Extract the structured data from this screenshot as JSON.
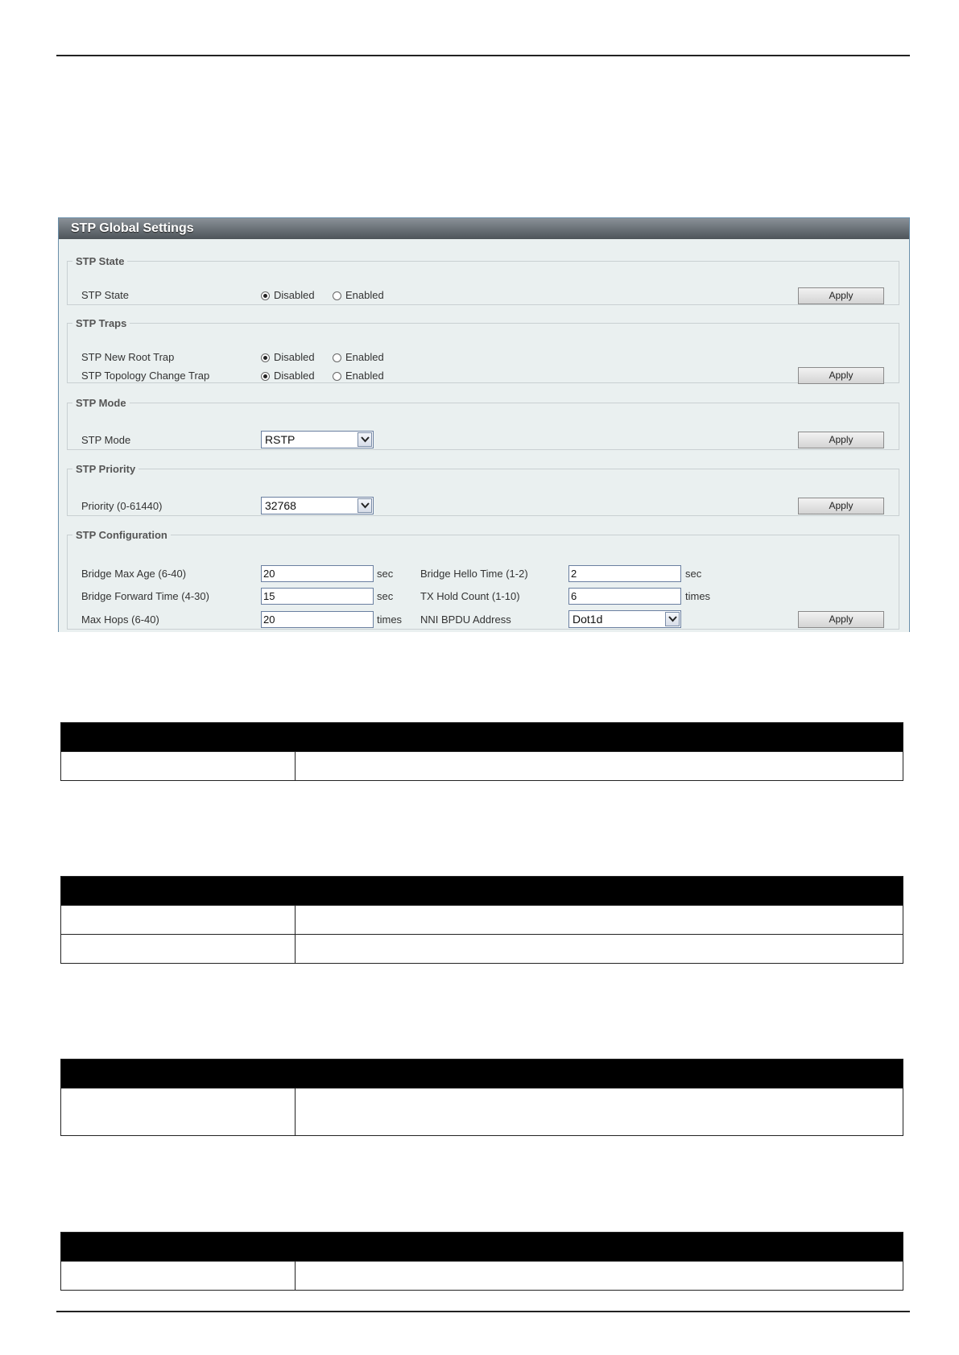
{
  "panel": {
    "title": "STP Global Settings"
  },
  "stp_state": {
    "legend": "STP State",
    "label": "STP State",
    "options": [
      "Disabled",
      "Enabled"
    ],
    "selected": "Disabled",
    "apply": "Apply"
  },
  "stp_traps": {
    "legend": "STP Traps",
    "rows": [
      {
        "label": "STP New Root Trap",
        "options": [
          "Disabled",
          "Enabled"
        ],
        "selected": "Disabled"
      },
      {
        "label": "STP Topology Change Trap",
        "options": [
          "Disabled",
          "Enabled"
        ],
        "selected": "Disabled"
      }
    ],
    "apply": "Apply"
  },
  "stp_mode": {
    "legend": "STP Mode",
    "label": "STP Mode",
    "value": "RSTP",
    "apply": "Apply"
  },
  "stp_priority": {
    "legend": "STP Priority",
    "label": "Priority (0-61440)",
    "value": "32768",
    "apply": "Apply"
  },
  "stp_config": {
    "legend": "STP Configuration",
    "bridge_max_age": {
      "label": "Bridge Max Age (6-40)",
      "value": "20",
      "unit": "sec"
    },
    "bridge_forward_time": {
      "label": "Bridge Forward Time (4-30)",
      "value": "15",
      "unit": "sec"
    },
    "max_hops": {
      "label": "Max Hops (6-40)",
      "value": "20",
      "unit": "times"
    },
    "bridge_hello_time": {
      "label": "Bridge Hello Time (1-2)",
      "value": "2",
      "unit": "sec"
    },
    "tx_hold_count": {
      "label": "TX Hold Count (1-10)",
      "value": "6",
      "unit": "times"
    },
    "nni_bpdu_address": {
      "label": "NNI BPDU Address",
      "value": "Dot1d"
    },
    "apply": "Apply"
  },
  "icons": {
    "radio": "radio-icon",
    "dropdown": "chevron-down-icon"
  }
}
